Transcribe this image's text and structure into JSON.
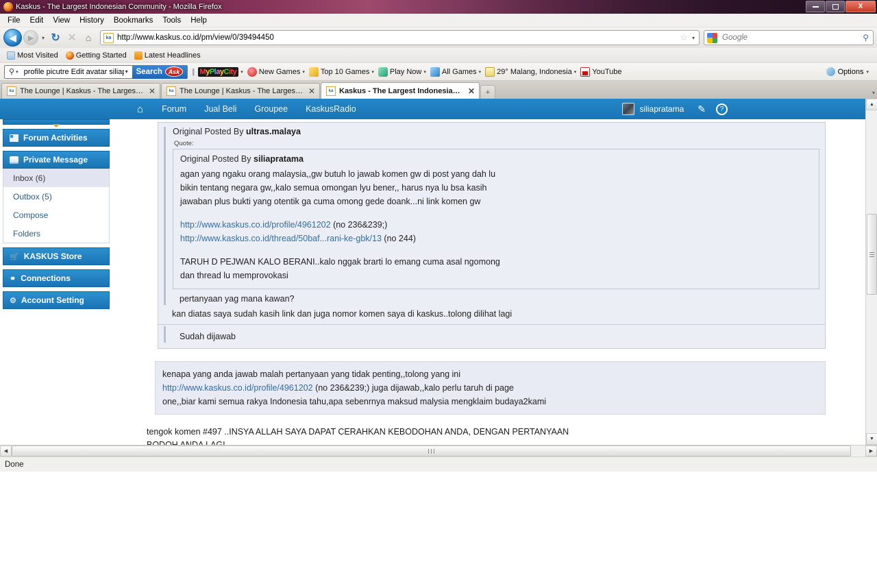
{
  "window": {
    "title": "Kaskus - The Largest Indonesian Community - Mozilla Firefox",
    "icon": "firefox-icon",
    "minimize_label": "Minimize",
    "maximize_label": "Maximize",
    "close_label": "X"
  },
  "menubar": {
    "items": [
      "File",
      "Edit",
      "View",
      "History",
      "Bookmarks",
      "Tools",
      "Help"
    ]
  },
  "navbar": {
    "back_glyph": "◀",
    "forward_glyph": "▶",
    "history_caret": "▾",
    "reload_glyph": "↻",
    "stop_glyph": "✕",
    "home_glyph": "⌂",
    "url": "http://www.kaskus.co.id/pm/view/0/39494450",
    "url_favicon_text": "ka",
    "bookmark_star": "☆",
    "url_caret": "▾",
    "search_placeholder": "Google",
    "search_engine": "google-icon",
    "search_magnifier": "⚲"
  },
  "bookmarks": {
    "items": [
      {
        "label": "Most Visited",
        "icon": "most-visited-icon"
      },
      {
        "label": "Getting Started",
        "icon": "firefox-icon"
      },
      {
        "label": "Latest Headlines",
        "icon": "rss-icon"
      }
    ]
  },
  "asktoolbar": {
    "query_value": "profile picutre Edit avatar siliapr",
    "query_icon": "search-icon",
    "search_button": "Search",
    "brand": "Ask",
    "mpc_logo": "MyPlayCity",
    "items": [
      {
        "label": "New Games",
        "icon": "new-games-icon",
        "caret": "▾"
      },
      {
        "label": "Top 10 Games",
        "icon": "top-10-games-icon",
        "caret": "▾"
      },
      {
        "label": "Play Now",
        "icon": "play-now-icon",
        "caret": "▾"
      },
      {
        "label": "All Games",
        "icon": "all-games-icon",
        "caret": "▾"
      },
      {
        "label": "29° Malang, Indonesia",
        "icon": "weather-icon",
        "caret": "▾"
      },
      {
        "label": "YouTube",
        "icon": "youtube-icon",
        "caret": ""
      }
    ],
    "options_label": "Options",
    "options_caret": "▾"
  },
  "tabs": {
    "items": [
      {
        "label": "The Lounge | Kaskus - The Largest I...",
        "active": false,
        "close": "✕"
      },
      {
        "label": "The Lounge | Kaskus - The Largest I...",
        "active": false,
        "close": "✕"
      },
      {
        "label": "Kaskus - The Largest Indonesian C...",
        "active": true,
        "close": "✕"
      }
    ],
    "new_tab_glyph": "+",
    "list_all_glyph": "▾"
  },
  "site": {
    "nav": {
      "home_icon": "home-icon",
      "items": [
        "Forum",
        "Jual Beli",
        "Groupee",
        "KaskusRadio"
      ],
      "username": "siliapratama",
      "avatar": "user-avatar",
      "edit_icon": "✎",
      "help_icon": "?"
    },
    "sidebar": {
      "sections": [
        {
          "label": "Forum Activities",
          "icon": "forum-activities-icon",
          "items": []
        },
        {
          "label": "Private Message",
          "icon": "envelope-icon",
          "items": [
            {
              "label": "Inbox (6)",
              "selected": true
            },
            {
              "label": "Outbox (5)",
              "selected": false
            },
            {
              "label": "Compose",
              "selected": false
            },
            {
              "label": "Folders",
              "selected": false
            }
          ]
        },
        {
          "label": "KASKUS Store",
          "icon": "cart-icon",
          "items": []
        },
        {
          "label": "Connections",
          "icon": "connections-icon",
          "items": []
        },
        {
          "label": "Account Setting",
          "icon": "gear-icon",
          "items": []
        }
      ]
    },
    "message": {
      "quote_l1_prefix": "Original Posted By",
      "quote_l1_author": "ultras.malaya",
      "quote_label": "Quote:",
      "quote_l2_prefix": "Original Posted By",
      "quote_l2_author": "siliapratama",
      "quote_l2_body": [
        "agan yang ngaku orang malaysia,,gw butuh lo jawab komen gw di post yang dah lu",
        "bikin tentang negara gw,,kalo semua omongan lyu bener,, harus nya lu bsa kasih",
        "jawaban plus bukti yang otentik ga cuma omong gede doank...ni link komen gw"
      ],
      "quote_links": [
        {
          "url": "http://www.kaskus.co.id/profile/4961202",
          "suffix": "(no 236&239;)"
        },
        {
          "url": "http://www.kaskus.co.id/thread/50baf...rani-ke-gbk/13",
          "suffix": "(no 244)"
        }
      ],
      "quote_l2_tail": [
        "TARUH D PEJWAN KALO BERANI..kalo nggak brarti lo emang cuma asal ngomong",
        "dan thread lu memprovokasi"
      ],
      "reply_inner": "pertanyaan yag mana kawan?",
      "reply_level2": "kan diatas saya sudah kasih link dan juga nomor komen saya di kaskus..tolong dilihat lagi",
      "reply_level1": "Sudah dijawab",
      "post_body_lines": [
        "kenapa yang anda jawab malah pertanyaan yang tidak penting,,tolong yang ini",
        "one,,biar kami semua rakya Indonesia tahu,apa sebenrnya maksud malysia mengklaim budaya2kami"
      ],
      "post_body_link": "http://www.kaskus.co.id/profile/4961202",
      "post_body_link_tail": "(no 236&239;) juga dijawab,,kalo perlu taruh di page",
      "plain_post_lines": [
        "tengok komen #497 ..INSYA ALLAH SAYA DAPAT CERAHKAN KEBODOHAN ANDA, DENGAN PERTANYAAN",
        "BODOH ANDA LAGI"
      ]
    }
  },
  "scrollbars": {
    "v_up": "▲",
    "v_down": "▼",
    "h_left": "◀",
    "h_right": "▶"
  },
  "statusbar": {
    "text": "Done"
  },
  "colors": {
    "kaskus_blue": "#1a74b4",
    "link_blue": "#2f6fa8",
    "quote_bg": "#eceef6",
    "selected_bg": "#e2e4f2"
  }
}
